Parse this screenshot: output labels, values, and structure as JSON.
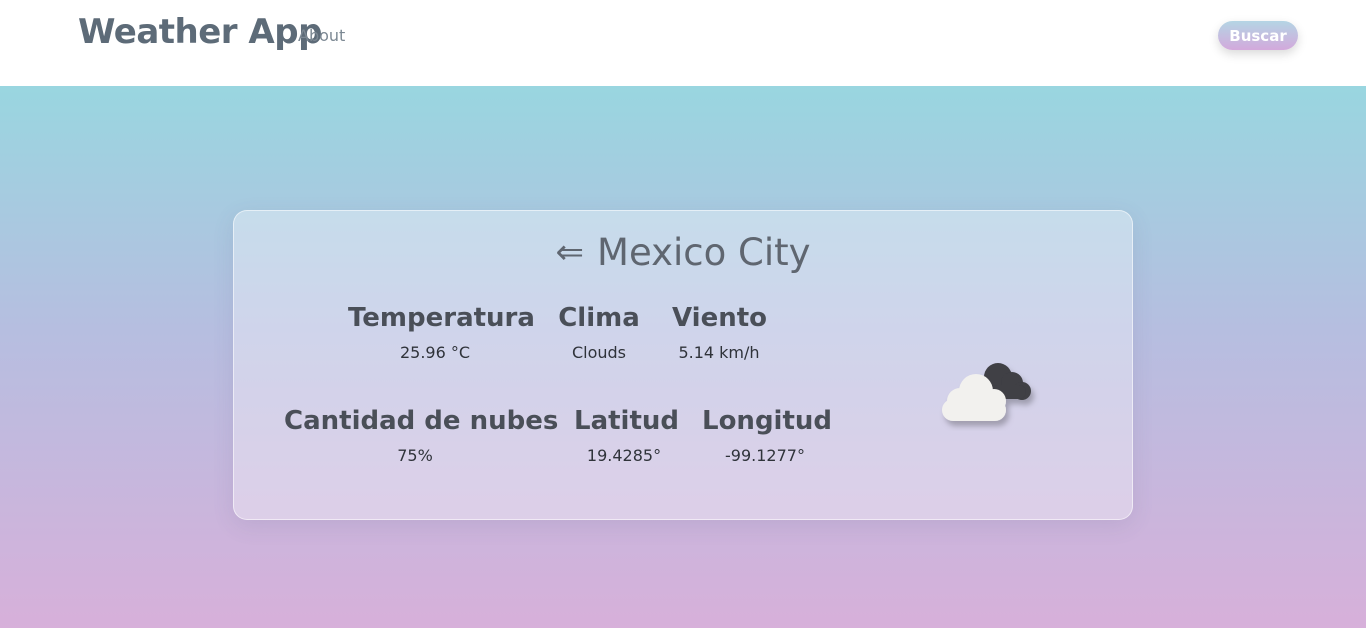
{
  "navbar": {
    "brand": "Weather App",
    "about_label": "About",
    "search_label": "Buscar"
  },
  "card": {
    "back_icon": "left-arrow-icon",
    "back_glyph": "⇐",
    "city": "Mexico City",
    "stats": {
      "temperature": {
        "label": "Temperatura",
        "value": "25.96 °C"
      },
      "weather": {
        "label": "Clima",
        "value": "Clouds"
      },
      "wind": {
        "label": "Viento",
        "value": "5.14 km/h"
      },
      "clouds": {
        "label": "Cantidad de nubes",
        "value": "75%"
      },
      "latitude": {
        "label": "Latitud",
        "value": "19.4285°"
      },
      "longitude": {
        "label": "Longitud",
        "value": "-99.1277°"
      }
    },
    "weather_icon": "broken-clouds-icon"
  },
  "colors": {
    "gradient_top": "#99d6e0",
    "gradient_bottom": "#d7b0da",
    "brand_text": "#5d6b78"
  }
}
